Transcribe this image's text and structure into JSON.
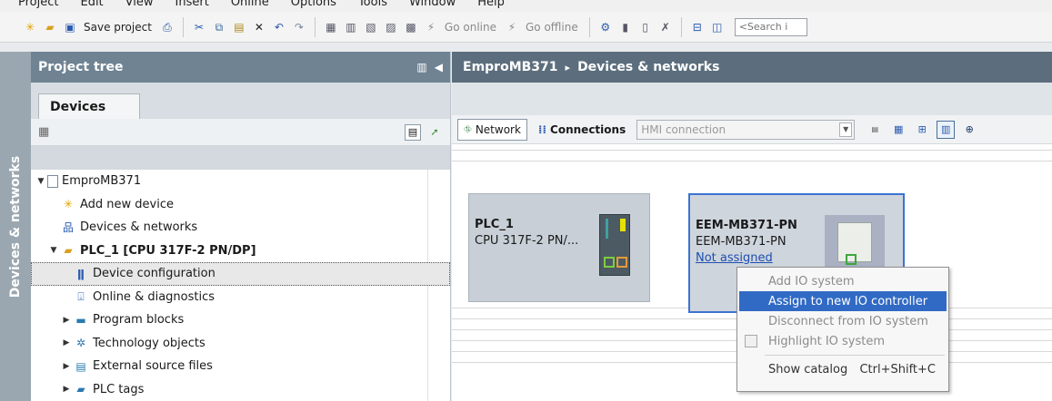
{
  "menu": [
    "Project",
    "Edit",
    "View",
    "Insert",
    "Online",
    "Options",
    "Tools",
    "Window",
    "Help"
  ],
  "toolbar": {
    "save_label": "Save project",
    "go_online": "Go online",
    "go_offline": "Go offline",
    "search_placeholder": "<Search i"
  },
  "side_strip": "Devices & networks",
  "project_tree": {
    "title": "Project tree",
    "tab": "Devices",
    "items": [
      {
        "label": "EmproMB371",
        "level": 0,
        "expanded": true,
        "icon": "project-icon"
      },
      {
        "label": "Add new device",
        "level": 1,
        "icon": "add-device-icon"
      },
      {
        "label": "Devices & networks",
        "level": 1,
        "icon": "network-icon"
      },
      {
        "label": "PLC_1 [CPU 317F-2 PN/DP]",
        "level": 1,
        "expanded": true,
        "icon": "plc-folder-icon"
      },
      {
        "label": "Device configuration",
        "level": 2,
        "icon": "device-config-icon",
        "selected": true
      },
      {
        "label": "Online & diagnostics",
        "level": 2,
        "icon": "diagnostics-icon"
      },
      {
        "label": "Program blocks",
        "level": 2,
        "collapsed": true,
        "icon": "program-blocks-icon"
      },
      {
        "label": "Technology objects",
        "level": 2,
        "collapsed": true,
        "icon": "technology-icon"
      },
      {
        "label": "External source files",
        "level": 2,
        "collapsed": true,
        "icon": "source-files-icon"
      },
      {
        "label": "PLC tags",
        "level": 2,
        "collapsed": true,
        "icon": "plc-tags-icon"
      }
    ]
  },
  "editor": {
    "breadcrumb_project": "EmproMB371",
    "breadcrumb_sep": "▸",
    "breadcrumb_view": "Devices & networks",
    "network_label": "Network",
    "connections_label": "Connections",
    "connection_type": "HMI connection"
  },
  "devices": {
    "plc": {
      "name": "PLC_1",
      "type": "CPU 317F-2 PN/..."
    },
    "eem": {
      "name": "EEM-MB371-PN",
      "type": "EEM-MB371-PN",
      "status": "Not assigned"
    }
  },
  "context_menu": {
    "items": [
      {
        "label": "Add IO system",
        "enabled": false
      },
      {
        "label": "Assign to new IO controller",
        "enabled": true,
        "highlighted": true
      },
      {
        "label": "Disconnect from IO system",
        "enabled": false
      },
      {
        "label": "Highlight IO system",
        "enabled": false
      },
      {
        "label": "Show catalog",
        "enabled": true,
        "shortcut": "Ctrl+Shift+C"
      }
    ]
  },
  "colors": {
    "panel_title": "#6f8393",
    "editor_title": "#5c6e7d",
    "highlight": "#316ac5",
    "selected_device_border": "#3b73d1"
  }
}
